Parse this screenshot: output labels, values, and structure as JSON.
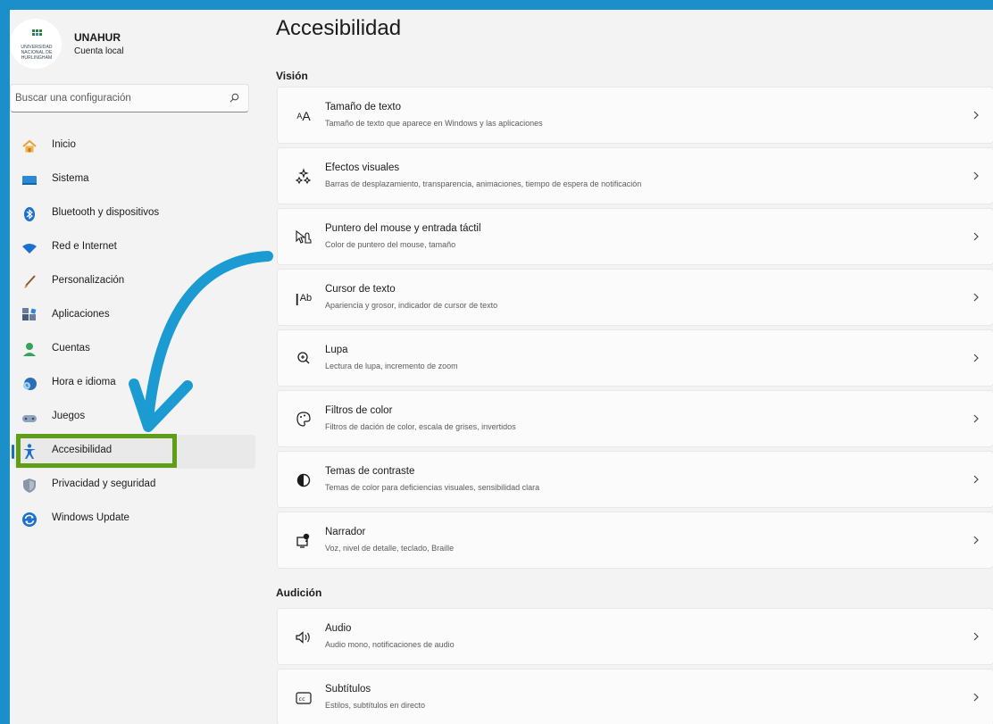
{
  "account": {
    "logo_text": "Universidad Nacional de Hurlingham",
    "name": "UNAHUR",
    "type": "Cuenta local"
  },
  "search": {
    "placeholder": "Buscar una configuración"
  },
  "nav": [
    {
      "label": "Inicio",
      "icon": "home-icon"
    },
    {
      "label": "Sistema",
      "icon": "system-icon"
    },
    {
      "label": "Bluetooth y dispositivos",
      "icon": "bluetooth-icon"
    },
    {
      "label": "Red e Internet",
      "icon": "network-icon"
    },
    {
      "label": "Personalización",
      "icon": "brush-icon"
    },
    {
      "label": "Aplicaciones",
      "icon": "apps-icon"
    },
    {
      "label": "Cuentas",
      "icon": "account-icon"
    },
    {
      "label": "Hora e idioma",
      "icon": "time-language-icon"
    },
    {
      "label": "Juegos",
      "icon": "gamepad-icon"
    },
    {
      "label": "Accesibilidad",
      "icon": "accessibility-icon",
      "active": true
    },
    {
      "label": "Privacidad y seguridad",
      "icon": "shield-icon"
    },
    {
      "label": "Windows Update",
      "icon": "update-icon"
    }
  ],
  "main": {
    "title": "Accesibilidad",
    "sections": [
      {
        "title": "Visión",
        "items": [
          {
            "title": "Tamaño de texto",
            "subtitle": "Tamaño de texto que aparece en Windows y las aplicaciones",
            "icon": "text-size-icon"
          },
          {
            "title": "Efectos visuales",
            "subtitle": "Barras de desplazamiento, transparencia, animaciones, tiempo de espera de notificación",
            "icon": "visual-effects-icon"
          },
          {
            "title": "Puntero del mouse y entrada táctil",
            "subtitle": "Color de puntero del mouse, tamaño",
            "icon": "mouse-pointer-icon"
          },
          {
            "title": "Cursor de texto",
            "subtitle": "Apariencia y grosor, indicador de cursor de texto",
            "icon": "text-cursor-icon"
          },
          {
            "title": "Lupa",
            "subtitle": "Lectura de lupa, incremento de zoom",
            "icon": "magnifier-icon"
          },
          {
            "title": "Filtros de color",
            "subtitle": "Filtros de dación de color, escala de grises, invertidos",
            "icon": "color-filter-icon"
          },
          {
            "title": "Temas de contraste",
            "subtitle": "Temas de color para deficiencias visuales, sensibilidad clara",
            "icon": "contrast-icon"
          },
          {
            "title": "Narrador",
            "subtitle": "Voz, nivel de detalle, teclado, Braille",
            "icon": "narrator-icon"
          }
        ]
      },
      {
        "title": "Audición",
        "items": [
          {
            "title": "Audio",
            "subtitle": "Audio mono, notificaciones de audio",
            "icon": "audio-icon"
          },
          {
            "title": "Subtítulos",
            "subtitle": "Estilos, subtítulos en directo",
            "icon": "captions-icon"
          }
        ]
      }
    ]
  },
  "colors": {
    "frame": "#1a8fc9",
    "annotation_arrow": "#1b9bd1",
    "highlight_box": "#5e9e18",
    "accent": "#1a6fb6"
  }
}
